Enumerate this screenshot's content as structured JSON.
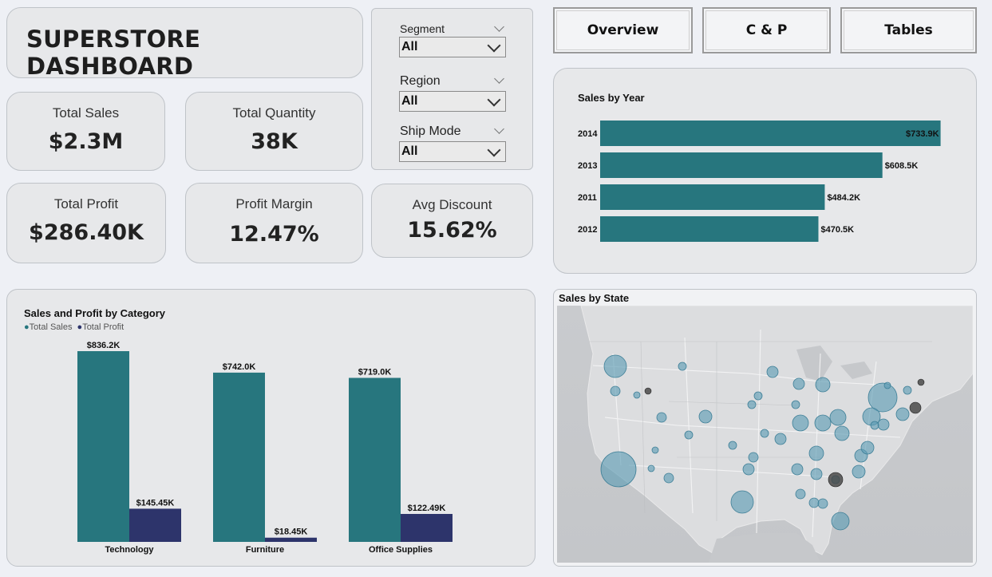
{
  "header": {
    "title": "SUPERSTORE DASHBOARD"
  },
  "kpis": {
    "total_sales": {
      "label": "Total Sales",
      "value": "$2.3M"
    },
    "total_quantity": {
      "label": "Total Quantity",
      "value": "38K"
    },
    "total_profit": {
      "label": "Total Profit",
      "value": "$286.40K"
    },
    "profit_margin": {
      "label": "Profit Margin",
      "value": "12.47%"
    },
    "avg_discount": {
      "label": "Avg Discount",
      "value": "15.62%"
    }
  },
  "filters": {
    "segment": {
      "label": "Segment",
      "value": "All"
    },
    "region": {
      "label": "Region",
      "value": "All"
    },
    "ship_mode": {
      "label": "Ship Mode",
      "value": "All"
    }
  },
  "nav": {
    "overview": "Overview",
    "cp": "C & P",
    "tables": "Tables"
  },
  "colors": {
    "teal": "#27767e",
    "navy": "#2d346b",
    "card_bg": "#e7e8ea",
    "page_bg": "#eef0f5"
  },
  "icons": {
    "dropdown": "chevron-down-icon"
  },
  "chart_data": [
    {
      "type": "bar",
      "orientation": "horizontal",
      "title": "Sales by Year",
      "categories": [
        "2014",
        "2013",
        "2011",
        "2012"
      ],
      "values": [
        733.9,
        608.5,
        484.2,
        470.5
      ],
      "data_labels": [
        "$733.9K",
        "$608.5K",
        "$484.2K",
        "$470.5K"
      ],
      "units": "K USD",
      "xlim": [
        0,
        800
      ],
      "grid": false
    },
    {
      "type": "bar",
      "title": "Sales and Profit by Category",
      "categories": [
        "Technology",
        "Furniture",
        "Office Supplies"
      ],
      "series": [
        {
          "name": "Total Sales",
          "values": [
            836.2,
            742.0,
            719.0
          ],
          "labels": [
            "$836.2K",
            "$742.0K",
            "$719.0K"
          ]
        },
        {
          "name": "Total Profit",
          "values": [
            145.45,
            18.45,
            122.49
          ],
          "labels": [
            "$145.45K",
            "$18.45K",
            "$122.49K"
          ]
        }
      ],
      "units": "K USD",
      "ylim": [
        0,
        860
      ],
      "legend_position": "top-left",
      "grid": false
    },
    {
      "type": "scatter",
      "title": "Sales by State",
      "map_base": "United States",
      "mark": "bubble"
    }
  ]
}
